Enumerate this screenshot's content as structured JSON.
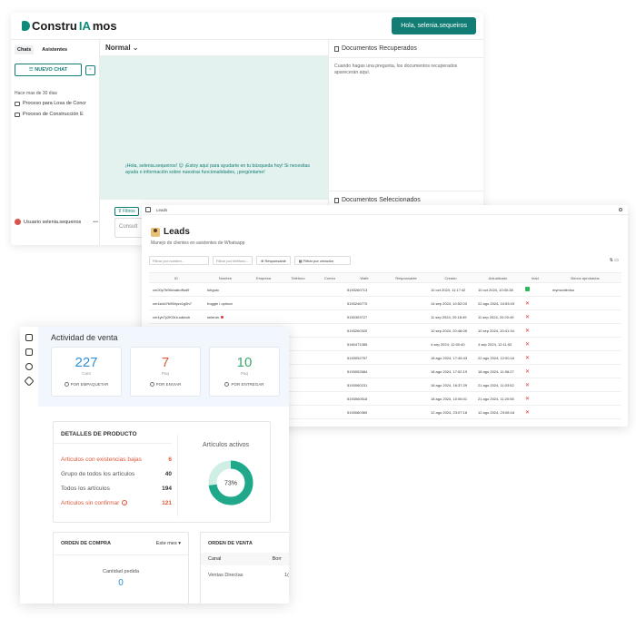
{
  "chat": {
    "logo_part1": "Constru",
    "logo_part2": "IA",
    "logo_part3": "mos",
    "greeting_button": "Hola, selenia.sequeiros",
    "tabs": [
      "Chats",
      "Asistentes"
    ],
    "new_chat_label": "NUEVO CHAT",
    "section_label": "Hace mas de 30 dias",
    "history": [
      "Proceso para Losa de Concr",
      "Proceso de Construcción E"
    ],
    "user_name": "Usuario selenia.sequeiros",
    "mode_label": "Normal",
    "welcome_message": "¡Hola, selenia.sequeiros! 😊 ¡Estoy aquí para ayudarte en tu búsqueda hoy! Si necesitas ayuda o información sobre nuestras funcionalidades, ¡pregúntame!",
    "filter_label": "Filtros",
    "input_placeholder": "Consult",
    "docs_recovered_title": "Documentos Recuperados",
    "docs_recovered_body": "Cuando hagas una pregunta, los documentos recuperados aparecerán aquí.",
    "docs_selected_title": "Documentos Seleccionados"
  },
  "leads": {
    "tab_label": "Leads",
    "title": "Leads",
    "subtitle": "Manejo de clientes en asistentes de Whatsapp",
    "filters": {
      "name_placeholder": "Filtrar por nombre...",
      "phone_placeholder": "Filtrar por teléfono...",
      "responsible_label": "Responsable",
      "date_label": "Filtrar por creación"
    },
    "columns": [
      "ID",
      "Nombre",
      "Empresa",
      "Teléfono",
      "Correo",
      "Wafe",
      "Responsable",
      "Creado",
      "Actualizado",
      "lead",
      "Bonos aprobados"
    ],
    "rows": [
      {
        "id": "cm20y7b96xnaboffud9",
        "nombre": "luhguio",
        "wafe": "5193260713",
        "creado": "10 oct 2024, 11:17:42",
        "actualizado": "10 oct 2024, 10:00:38",
        "lead": "ok",
        "bonos": "mymovileviso"
      },
      {
        "id": "cm1slxb7b95hyzx1g5n7",
        "nombre": "froggie l opriccx",
        "wafe": "5193246770",
        "creado": "14 sep 2024, 10:52:03",
        "actualizado": "22 ago 2024, 10:53:03",
        "lead": "x",
        "bonos": ""
      },
      {
        "id": "cm1yb7y2f03r1uuikxuh",
        "nombre": "selenia",
        "wafe": "5150353727",
        "creado": "11 sep 2024, 20:18:49",
        "actualizado": "11 sep 2024, 20:20:49",
        "lead": "x",
        "bonos": ""
      },
      {
        "id": "",
        "nombre": "",
        "wafe": "5193260320",
        "creado": "10 sep 2024, 20:48:08",
        "actualizado": "10 sep 2024, 20:41:34",
        "lead": "x",
        "bonos": ""
      },
      {
        "id": "",
        "nombre": "",
        "wafe": "5160471085",
        "creado": "4 sep 2024, 12:00:40",
        "actualizado": "4 sep 2024, 12:11:52",
        "lead": "x",
        "bonos": ""
      },
      {
        "id": "",
        "nombre": "",
        "wafe": "5193052757",
        "creado": "18 ago 2024, 17:45:43",
        "actualizado": "22 ago 2024, 12:00:16",
        "lead": "x",
        "bonos": ""
      },
      {
        "id": "",
        "nombre": "",
        "wafe": "5193052684",
        "creado": "18 ago 2024, 17:52:19",
        "actualizado": "18 ago 2024, 11:06:27",
        "lead": "x",
        "bonos": ""
      },
      {
        "id": "",
        "nombre": "",
        "wafe": "5193060231",
        "creado": "18 ago 2024, 16:37:29",
        "actualizado": "21 ago 2024, 11:03:52",
        "lead": "x",
        "bonos": ""
      },
      {
        "id": "",
        "nombre": "",
        "wafe": "5193060518",
        "creado": "18 ago 2024, 10:06:01",
        "actualizado": "21 ago 2024, 11:20:55",
        "lead": "x",
        "bonos": ""
      },
      {
        "id": "",
        "nombre": "",
        "wafe": "5193080369",
        "creado": "12 ago 2024, 23:07:16",
        "actualizado": "12 ago 2024, 23:08:18",
        "lead": "x",
        "bonos": ""
      }
    ]
  },
  "sales": {
    "activity_title": "Actividad de venta",
    "cards": [
      {
        "value": "227",
        "unit": "Cant",
        "action": "POR EMPAQUETAR",
        "color": "#2f8fd6"
      },
      {
        "value": "7",
        "unit": "Paq",
        "action": "POR ENVIAR",
        "color": "#e0563b"
      },
      {
        "value": "10",
        "unit": "Paq",
        "action": "POR ENTREGAR",
        "color": "#3aa76d"
      }
    ],
    "product_title": "DETALLES DE PRODUCTO",
    "product_rows": [
      {
        "label": "Artículos con existencias bajas",
        "value": "6",
        "warn": true
      },
      {
        "label": "Grupo de todos los artículos",
        "value": "40",
        "warn": false
      },
      {
        "label": "Todos los artículos",
        "value": "194",
        "warn": false
      },
      {
        "label": "Artículos sin confirmar",
        "value": "121",
        "warn": true
      }
    ],
    "active_title": "Artículos activos",
    "active_percent": 73,
    "active_label": "73%",
    "purchase_title": "ORDEN DE COMPRA",
    "purchase_period": "Este mes",
    "purchase_qty_label": "Cantidad pedida",
    "purchase_qty_value": "0",
    "sale_title": "ORDEN DE VENTA",
    "sale_col1": "Canal",
    "sale_col2": "Borr",
    "sale_row_label": "Ventas Directas",
    "sale_row_value": "1("
  }
}
